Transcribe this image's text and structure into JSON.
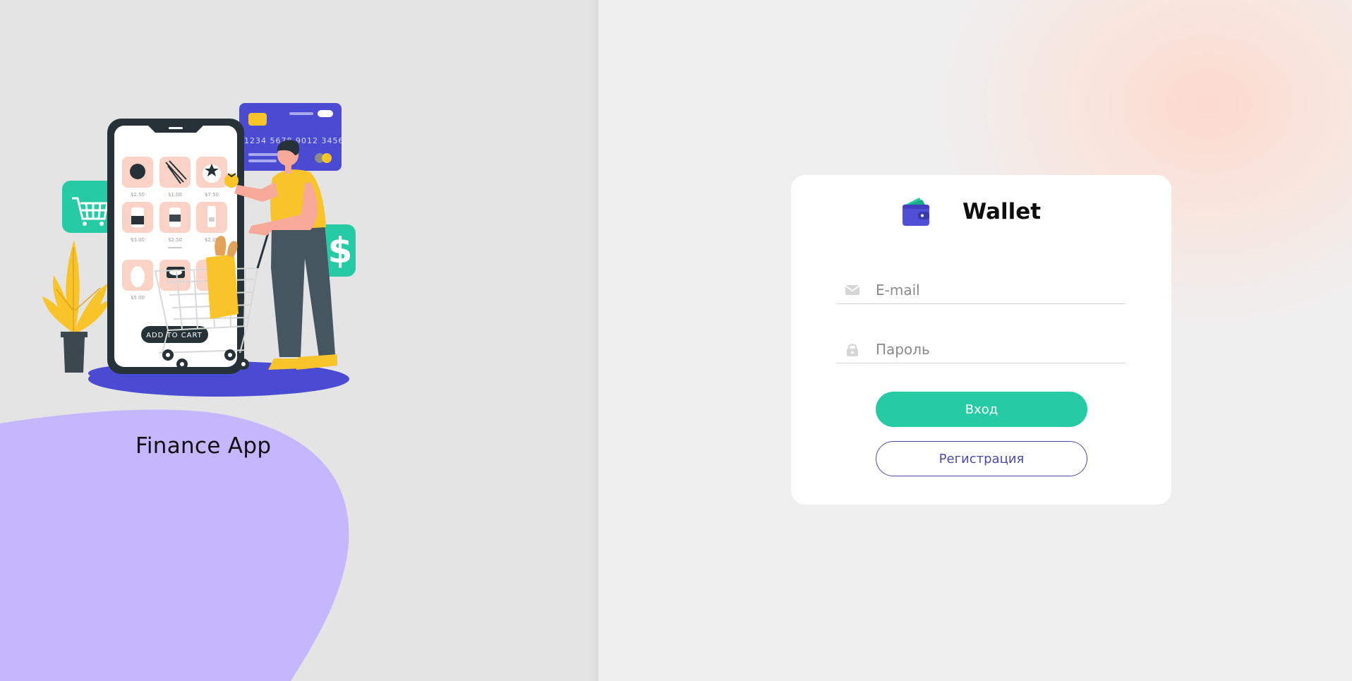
{
  "left": {
    "app_name": "Finance App",
    "illustration": {
      "card_number": "1234 5678 9012 3456",
      "cart_button_label": "ADD TO CART",
      "dollar_sign": "$",
      "prices": [
        "$2.50",
        "$1.00",
        "$7.50",
        "$3.00",
        "$2.50",
        "$2.00",
        "$5.00"
      ]
    }
  },
  "login": {
    "title": "Wallet",
    "email_placeholder": "E-mail",
    "password_placeholder": "Пароль",
    "login_button": "Вход",
    "register_button": "Регистрация"
  },
  "colors": {
    "accent_green": "#26cba6",
    "accent_indigo": "#4a4aa8",
    "wallet_blue": "#5050d6",
    "blob_purple": "#c4b7fd",
    "illustration_yellow": "#f9c32a"
  },
  "icons": {
    "logo": "wallet-icon",
    "email": "envelope-icon",
    "password": "lock-icon"
  }
}
